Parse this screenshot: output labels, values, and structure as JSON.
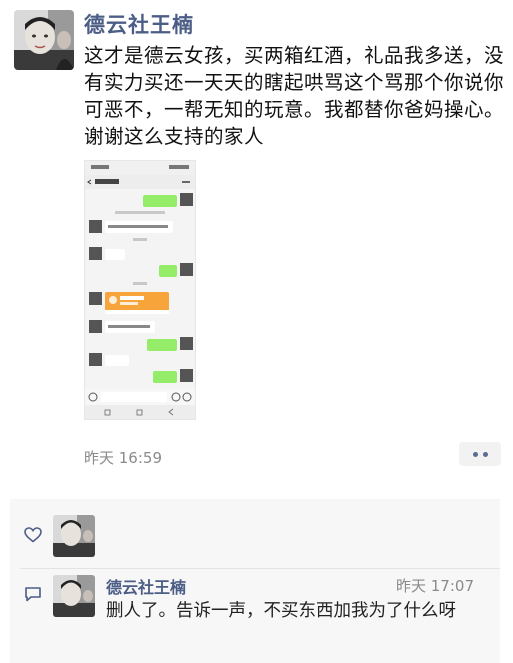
{
  "post": {
    "author": "德云社王楠",
    "text": "这才是德云女孩，买两箱红酒，礼品我多送，没有实力买还一天天的瞎起哄骂这个骂那个你说你可恶不，一帮无知的玩意。我都替你爸妈操心。谢谢这么支持的家人",
    "time": "昨天 16:59"
  },
  "comment": {
    "author": "德云社王楠",
    "time": "昨天 17:07",
    "text": "删人了。告诉一声，不买东西加我为了什么呀"
  },
  "icons": {
    "like": "heart-outline-icon",
    "comment": "comment-icon",
    "more": "more-dots-icon"
  },
  "colors": {
    "name_link": "#4c5d86",
    "chat_green": "#95ec69",
    "transfer_orange": "#f7a43a"
  }
}
